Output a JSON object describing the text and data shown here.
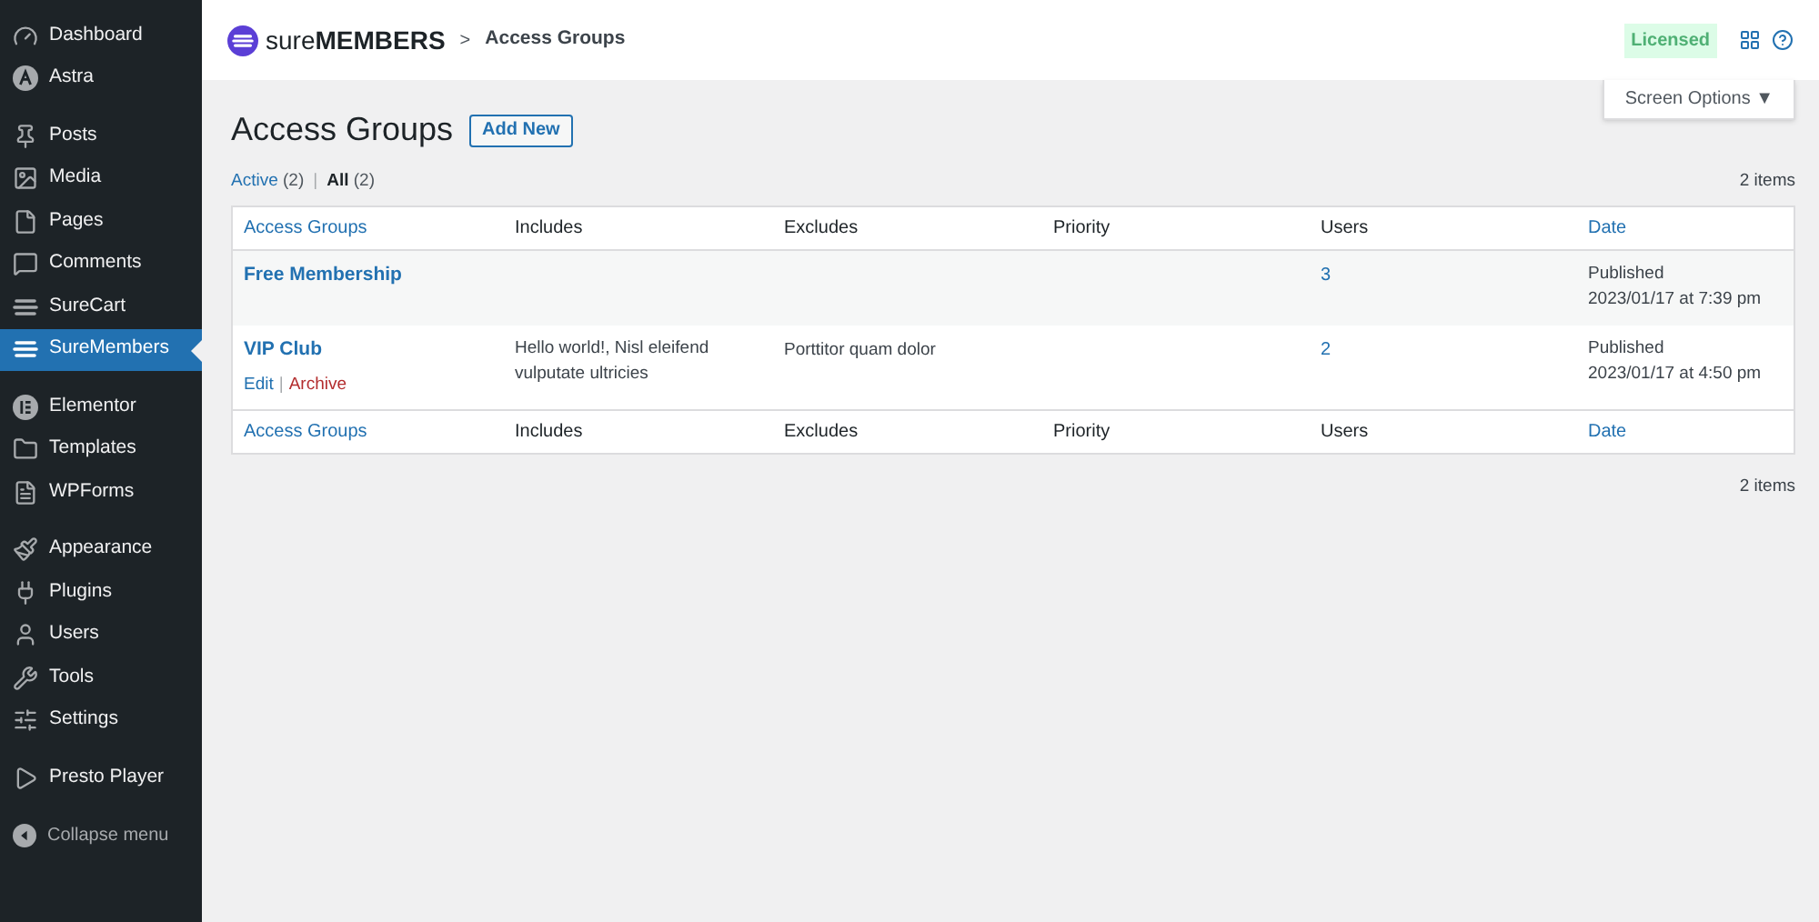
{
  "sidebar": {
    "groups": [
      [
        {
          "label": "Dashboard",
          "selected": false
        },
        {
          "label": "Astra",
          "selected": false
        }
      ],
      [
        {
          "label": "Posts",
          "selected": false
        },
        {
          "label": "Media",
          "selected": false
        },
        {
          "label": "Pages",
          "selected": false
        },
        {
          "label": "Comments",
          "selected": false
        },
        {
          "label": "SureCart",
          "selected": false
        },
        {
          "label": "SureMembers",
          "selected": true
        }
      ],
      [
        {
          "label": "Elementor",
          "selected": false
        },
        {
          "label": "Templates",
          "selected": false
        },
        {
          "label": "WPForms",
          "selected": false
        }
      ],
      [
        {
          "label": "Appearance",
          "selected": false
        },
        {
          "label": "Plugins",
          "selected": false
        },
        {
          "label": "Users",
          "selected": false
        },
        {
          "label": "Tools",
          "selected": false
        },
        {
          "label": "Settings",
          "selected": false
        }
      ],
      [
        {
          "label": "Presto Player",
          "selected": false
        }
      ]
    ],
    "collapse": "Collapse menu"
  },
  "header": {
    "logo_light": "sure",
    "logo_bold": "MEMBERS",
    "separator": ">",
    "breadcrumb": "Access Groups",
    "badge": "Licensed"
  },
  "screen_options": "Screen Options ▼",
  "title": "Access Groups",
  "add_new": "Add New",
  "filters": [
    {
      "label": "Active",
      "count": "(2)",
      "selected": false
    },
    {
      "label": "All",
      "count": "(2)",
      "selected": true
    }
  ],
  "filter_separator": "|",
  "items_count_top": "2 items",
  "items_count_bottom": "2 items",
  "table": {
    "columns": [
      {
        "label": "Access Groups",
        "link": true
      },
      {
        "label": "Includes",
        "link": false
      },
      {
        "label": "Excludes",
        "link": false
      },
      {
        "label": "Priority",
        "link": false
      },
      {
        "label": "Users",
        "link": false
      },
      {
        "label": "Date",
        "link": true
      }
    ],
    "footer_columns": [
      {
        "label": "Access Groups",
        "link": true
      },
      {
        "label": "Includes",
        "link": false
      },
      {
        "label": "Excludes",
        "link": false
      },
      {
        "label": "Priority",
        "link": false
      },
      {
        "label": "Users",
        "link": false
      },
      {
        "label": "Date",
        "link": true
      }
    ],
    "rows": [
      {
        "name": "Free Membership",
        "actions": [],
        "users": "3",
        "status": "Published",
        "date": "2023/01/17 at 7:39 pm"
      },
      {
        "name": "VIP Club",
        "actions": [
          {
            "label": "Edit",
            "kind": "edit"
          },
          {
            "label": "Archive",
            "kind": "delete"
          }
        ],
        "includes": "Hello world!, Nisl eleifend vulputate ultricies",
        "excludes": "Porttitor quam dolor",
        "users": "2",
        "status": "Published",
        "date": "2023/01/17 at 4:50 pm"
      }
    ]
  },
  "action_separator": "|"
}
